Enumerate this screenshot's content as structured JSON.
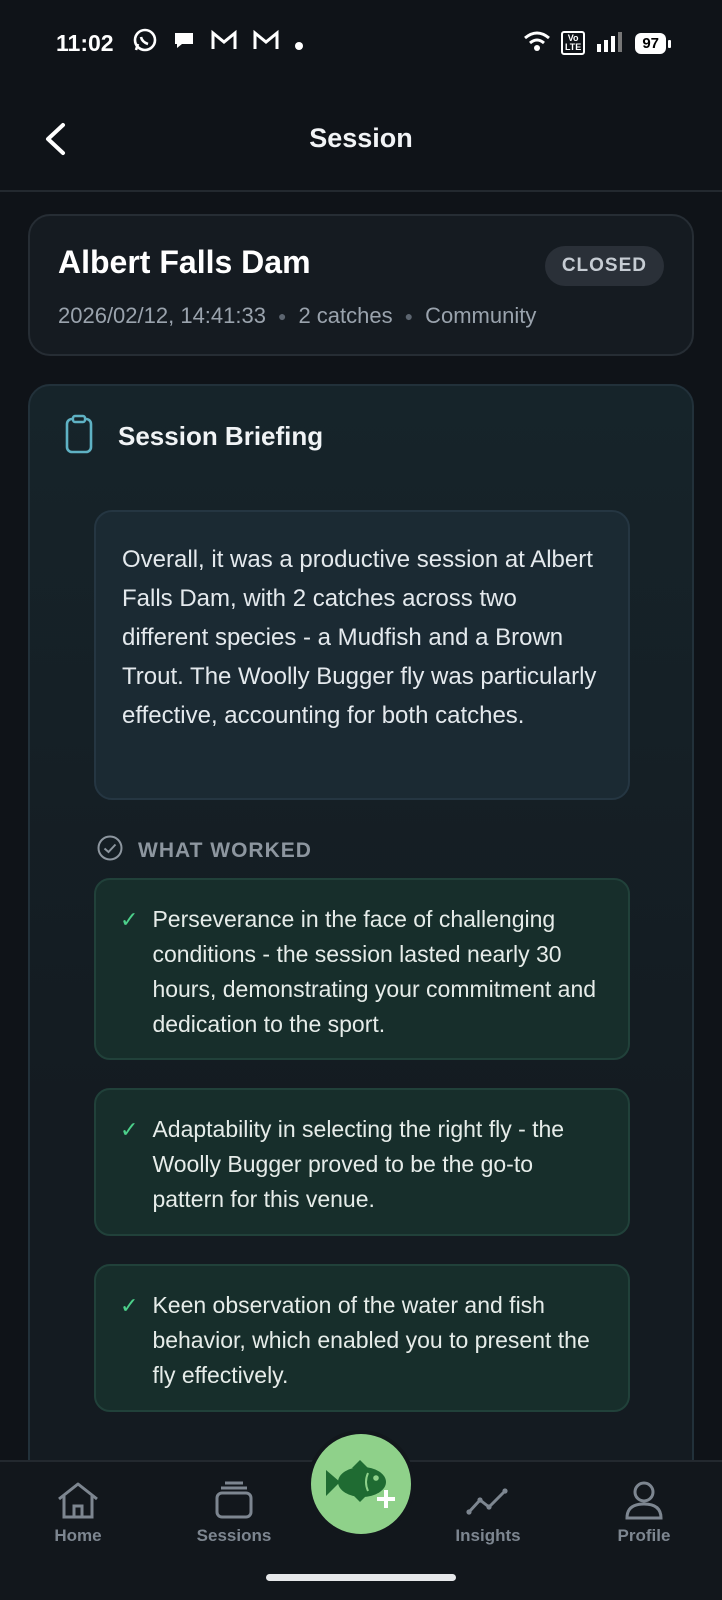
{
  "status_bar": {
    "time": "11:02",
    "notification_icons": [
      "whatsapp-icon",
      "chat-bubble-icon",
      "gmail-icon",
      "gmail-icon",
      "dot-icon"
    ],
    "volte_top": "Vo",
    "volte_bottom": "LTE",
    "battery": "97"
  },
  "header": {
    "title": "Session"
  },
  "session": {
    "venue": "Albert Falls Dam",
    "status": "CLOSED",
    "datetime": "2026/02/12, 14:41:33",
    "catches": "2 catches",
    "visibility": "Community"
  },
  "briefing": {
    "title": "Session Briefing",
    "summary": "Overall, it was a productive session at Albert Falls Dam, with 2 catches across two different species - a Mudfish and a Brown Trout. The Woolly Bugger fly was particularly effective, accounting for both catches.",
    "what_worked_label": "WHAT WORKED",
    "check_symbol": "✓",
    "what_worked": [
      "Perseverance in the face of challenging conditions - the session lasted nearly 30 hours, demonstrating your commitment and dedication to the sport.",
      "Adaptability in selecting the right fly - the Woolly Bugger proved to be the go-to pattern for this venue.",
      "Keen observation of the water and fish behavior, which enabled you to present the fly effectively."
    ]
  },
  "nav": {
    "items": [
      {
        "label": "Home",
        "icon": "home-icon"
      },
      {
        "label": "Sessions",
        "icon": "sessions-icon"
      },
      {
        "label": "Insights",
        "icon": "insights-icon"
      },
      {
        "label": "Profile",
        "icon": "profile-icon"
      }
    ],
    "fab_icon": "add-catch-fish-icon"
  },
  "colors": {
    "background": "#0f1318",
    "accent_green": "#4cd08a",
    "fab_green": "#8fd18a"
  }
}
